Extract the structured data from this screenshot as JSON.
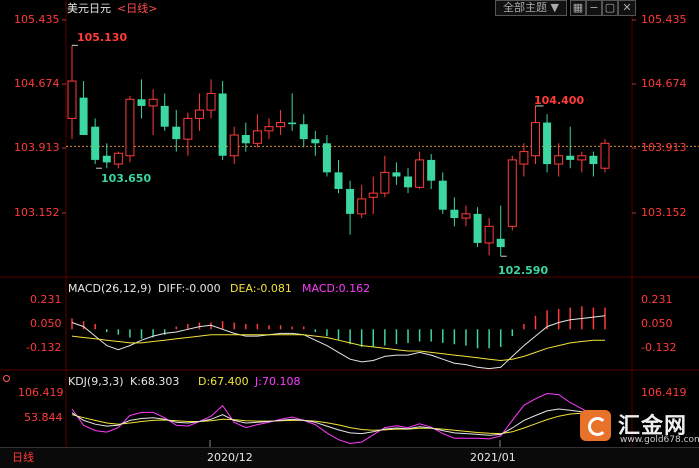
{
  "header": {
    "pair": "美元日元",
    "period_link": "<日线>",
    "theme_button": "全部主题",
    "dropdown_arrow": "▼"
  },
  "price_axis": {
    "labels": [
      "105.435",
      "104.674",
      "103.913",
      "103.152"
    ]
  },
  "annotations": {
    "high_left": "105.130",
    "low_left": "103.650",
    "high_right": "104.400",
    "low_bottom": "102.590"
  },
  "macd": {
    "title": "MACD(26,12,9)",
    "diff": "DIFF:-0.000",
    "dea": "DEA:-0.081",
    "macd": "MACD:0.162",
    "axis": [
      "0.231",
      "0.050",
      "-0.132"
    ]
  },
  "kdj": {
    "title": "KDJ(9,3,3)",
    "k": "K:68.303",
    "d": "D:67.400",
    "j": "J:70.108",
    "axis": [
      "106.419",
      "53.844"
    ]
  },
  "time_axis": {
    "labels": [
      "2020/12",
      "2021/01"
    ]
  },
  "bottom_tab": {
    "label": "日线"
  },
  "logo": {
    "name": "汇金网",
    "url": "www.gold678.com"
  },
  "colors": {
    "up": "#ff3b3b",
    "down": "#3cd6a0",
    "dea_line": "#f2e33a",
    "diff_line": "#e6e6e6",
    "j_line": "#ff3bff",
    "grid": "#5a0000",
    "dotted": "#d88b2e"
  },
  "chart_data": {
    "type": "candlestick",
    "price_range": [
      102.4,
      105.435
    ],
    "current_level": 103.913,
    "candles": [
      {
        "o": 104.25,
        "h": 105.13,
        "l": 104.0,
        "c": 104.7
      },
      {
        "o": 104.5,
        "h": 104.7,
        "l": 104.1,
        "c": 104.05
      },
      {
        "o": 104.15,
        "h": 104.25,
        "l": 103.7,
        "c": 103.75
      },
      {
        "o": 103.8,
        "h": 103.95,
        "l": 103.65,
        "c": 103.72
      },
      {
        "o": 103.7,
        "h": 103.85,
        "l": 103.65,
        "c": 103.83
      },
      {
        "o": 103.8,
        "h": 104.52,
        "l": 103.72,
        "c": 104.48
      },
      {
        "o": 104.48,
        "h": 104.72,
        "l": 104.25,
        "c": 104.4
      },
      {
        "o": 104.4,
        "h": 104.6,
        "l": 104.05,
        "c": 104.48
      },
      {
        "o": 104.4,
        "h": 104.55,
        "l": 104.1,
        "c": 104.15
      },
      {
        "o": 104.15,
        "h": 104.35,
        "l": 103.85,
        "c": 104.0
      },
      {
        "o": 104.0,
        "h": 104.32,
        "l": 103.8,
        "c": 104.25
      },
      {
        "o": 104.25,
        "h": 104.55,
        "l": 104.1,
        "c": 104.35
      },
      {
        "o": 104.35,
        "h": 104.72,
        "l": 104.25,
        "c": 104.55
      },
      {
        "o": 104.55,
        "h": 104.7,
        "l": 103.75,
        "c": 103.8
      },
      {
        "o": 103.8,
        "h": 104.15,
        "l": 103.7,
        "c": 104.05
      },
      {
        "o": 104.05,
        "h": 104.2,
        "l": 103.85,
        "c": 103.95
      },
      {
        "o": 103.95,
        "h": 104.3,
        "l": 103.9,
        "c": 104.1
      },
      {
        "o": 104.1,
        "h": 104.25,
        "l": 104.0,
        "c": 104.15
      },
      {
        "o": 104.15,
        "h": 104.35,
        "l": 104.05,
        "c": 104.2
      },
      {
        "o": 104.2,
        "h": 104.55,
        "l": 104.1,
        "c": 104.18
      },
      {
        "o": 104.18,
        "h": 104.3,
        "l": 103.9,
        "c": 104.0
      },
      {
        "o": 104.0,
        "h": 104.1,
        "l": 103.8,
        "c": 103.95
      },
      {
        "o": 103.95,
        "h": 104.05,
        "l": 103.55,
        "c": 103.6
      },
      {
        "o": 103.6,
        "h": 103.75,
        "l": 103.35,
        "c": 103.4
      },
      {
        "o": 103.4,
        "h": 103.5,
        "l": 102.85,
        "c": 103.1
      },
      {
        "o": 103.1,
        "h": 103.45,
        "l": 103.05,
        "c": 103.28
      },
      {
        "o": 103.3,
        "h": 103.55,
        "l": 103.1,
        "c": 103.35
      },
      {
        "o": 103.35,
        "h": 103.8,
        "l": 103.3,
        "c": 103.6
      },
      {
        "o": 103.6,
        "h": 103.72,
        "l": 103.45,
        "c": 103.55
      },
      {
        "o": 103.55,
        "h": 103.65,
        "l": 103.35,
        "c": 103.42
      },
      {
        "o": 103.42,
        "h": 103.85,
        "l": 103.4,
        "c": 103.75
      },
      {
        "o": 103.75,
        "h": 103.82,
        "l": 103.4,
        "c": 103.5
      },
      {
        "o": 103.5,
        "h": 103.6,
        "l": 103.1,
        "c": 103.15
      },
      {
        "o": 103.15,
        "h": 103.3,
        "l": 102.95,
        "c": 103.05
      },
      {
        "o": 103.05,
        "h": 103.2,
        "l": 102.95,
        "c": 103.1
      },
      {
        "o": 103.1,
        "h": 103.18,
        "l": 102.7,
        "c": 102.75
      },
      {
        "o": 102.75,
        "h": 103.05,
        "l": 102.6,
        "c": 102.95
      },
      {
        "o": 102.8,
        "h": 103.2,
        "l": 102.59,
        "c": 102.7
      },
      {
        "o": 102.95,
        "h": 103.8,
        "l": 102.9,
        "c": 103.75
      },
      {
        "o": 103.7,
        "h": 103.95,
        "l": 103.55,
        "c": 103.85
      },
      {
        "o": 103.8,
        "h": 104.4,
        "l": 103.7,
        "c": 104.2
      },
      {
        "o": 104.2,
        "h": 104.3,
        "l": 103.6,
        "c": 103.7
      },
      {
        "o": 103.7,
        "h": 103.95,
        "l": 103.55,
        "c": 103.8
      },
      {
        "o": 103.8,
        "h": 104.15,
        "l": 103.65,
        "c": 103.75
      },
      {
        "o": 103.75,
        "h": 103.85,
        "l": 103.6,
        "c": 103.8
      },
      {
        "o": 103.8,
        "h": 103.85,
        "l": 103.55,
        "c": 103.7
      },
      {
        "o": 103.65,
        "h": 104.0,
        "l": 103.6,
        "c": 103.95
      }
    ],
    "macd_hist": [
      0.08,
      0.06,
      0.04,
      -0.02,
      -0.04,
      -0.06,
      -0.07,
      -0.06,
      -0.04,
      0.02,
      0.04,
      0.05,
      0.05,
      0.06,
      0.05,
      0.04,
      0.04,
      0.03,
      0.03,
      0.02,
      0.02,
      -0.02,
      -0.05,
      -0.08,
      -0.11,
      -0.13,
      -0.13,
      -0.12,
      -0.11,
      -0.1,
      -0.09,
      -0.09,
      -0.1,
      -0.11,
      -0.12,
      -0.14,
      -0.14,
      -0.13,
      -0.05,
      0.04,
      0.1,
      0.14,
      0.15,
      0.16,
      0.17,
      0.16,
      0.16
    ],
    "diff_line": [
      0.05,
      0.02,
      -0.05,
      -0.12,
      -0.15,
      -0.12,
      -0.08,
      -0.05,
      -0.03,
      -0.02,
      0.0,
      0.02,
      0.03,
      0.0,
      -0.03,
      -0.05,
      -0.05,
      -0.04,
      -0.03,
      -0.03,
      -0.04,
      -0.08,
      -0.12,
      -0.17,
      -0.22,
      -0.24,
      -0.23,
      -0.2,
      -0.19,
      -0.19,
      -0.17,
      -0.19,
      -0.22,
      -0.25,
      -0.26,
      -0.28,
      -0.29,
      -0.28,
      -0.2,
      -0.12,
      -0.05,
      0.02,
      0.05,
      0.07,
      0.08,
      0.09,
      0.1
    ],
    "dea_line": [
      -0.05,
      -0.06,
      -0.07,
      -0.08,
      -0.09,
      -0.1,
      -0.1,
      -0.09,
      -0.08,
      -0.07,
      -0.06,
      -0.05,
      -0.04,
      -0.04,
      -0.04,
      -0.04,
      -0.04,
      -0.04,
      -0.04,
      -0.04,
      -0.04,
      -0.05,
      -0.06,
      -0.08,
      -0.1,
      -0.12,
      -0.13,
      -0.14,
      -0.15,
      -0.16,
      -0.16,
      -0.17,
      -0.18,
      -0.19,
      -0.2,
      -0.21,
      -0.22,
      -0.23,
      -0.22,
      -0.2,
      -0.17,
      -0.14,
      -0.12,
      -0.1,
      -0.09,
      -0.08,
      -0.081
    ],
    "kdj_k": [
      75,
      55,
      45,
      40,
      42,
      55,
      60,
      62,
      58,
      50,
      48,
      52,
      58,
      70,
      55,
      48,
      50,
      52,
      55,
      58,
      55,
      50,
      40,
      30,
      22,
      20,
      25,
      32,
      35,
      33,
      38,
      35,
      28,
      22,
      20,
      18,
      16,
      18,
      35,
      55,
      68,
      80,
      85,
      82,
      78,
      72,
      68
    ],
    "kdj_d": [
      70,
      62,
      55,
      48,
      45,
      48,
      52,
      55,
      56,
      54,
      52,
      52,
      54,
      58,
      57,
      54,
      53,
      53,
      54,
      55,
      55,
      53,
      49,
      43,
      36,
      31,
      29,
      30,
      32,
      32,
      34,
      34,
      32,
      29,
      26,
      23,
      21,
      20,
      25,
      35,
      46,
      57,
      66,
      72,
      74,
      73,
      67
    ],
    "kdj_j": [
      85,
      42,
      28,
      24,
      36,
      68,
      76,
      76,
      62,
      42,
      40,
      52,
      66,
      94,
      50,
      36,
      44,
      50,
      58,
      64,
      55,
      44,
      22,
      4,
      -6,
      -2,
      17,
      36,
      41,
      36,
      46,
      37,
      20,
      8,
      8,
      8,
      6,
      14,
      55,
      95,
      112,
      126,
      123,
      102,
      86,
      70,
      70
    ]
  }
}
